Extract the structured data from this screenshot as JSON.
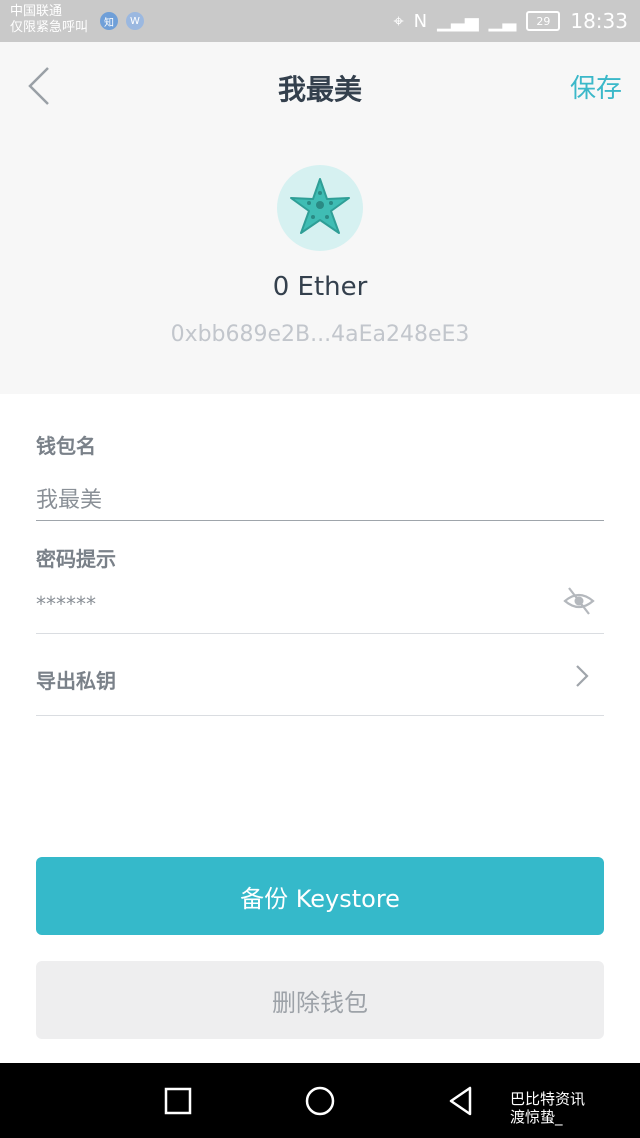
{
  "status_bar": {
    "carrier_line1": "中国联通",
    "carrier_line2": "仅限紧急呼叫",
    "badge1": "知",
    "badge2": "W",
    "battery": "29",
    "time": "18:33"
  },
  "header": {
    "title": "我最美",
    "save_label": "保存"
  },
  "wallet": {
    "avatar_icon": "starfish-icon",
    "balance": "0 Ether",
    "address": "0xbb689e2B...4aEa248eE3"
  },
  "form": {
    "name_label": "钱包名",
    "name_value": "我最美",
    "hint_label": "密码提示",
    "hint_value": "******",
    "export_label": "导出私钥"
  },
  "buttons": {
    "backup": "备份 Keystore",
    "delete": "删除钱包"
  },
  "watermark": {
    "line1": "巴比特资讯",
    "line2": "渡惊蛰_"
  },
  "colors": {
    "accent": "#35b9ca",
    "title": "#34404d",
    "status_bar": "#c9c9c9"
  }
}
